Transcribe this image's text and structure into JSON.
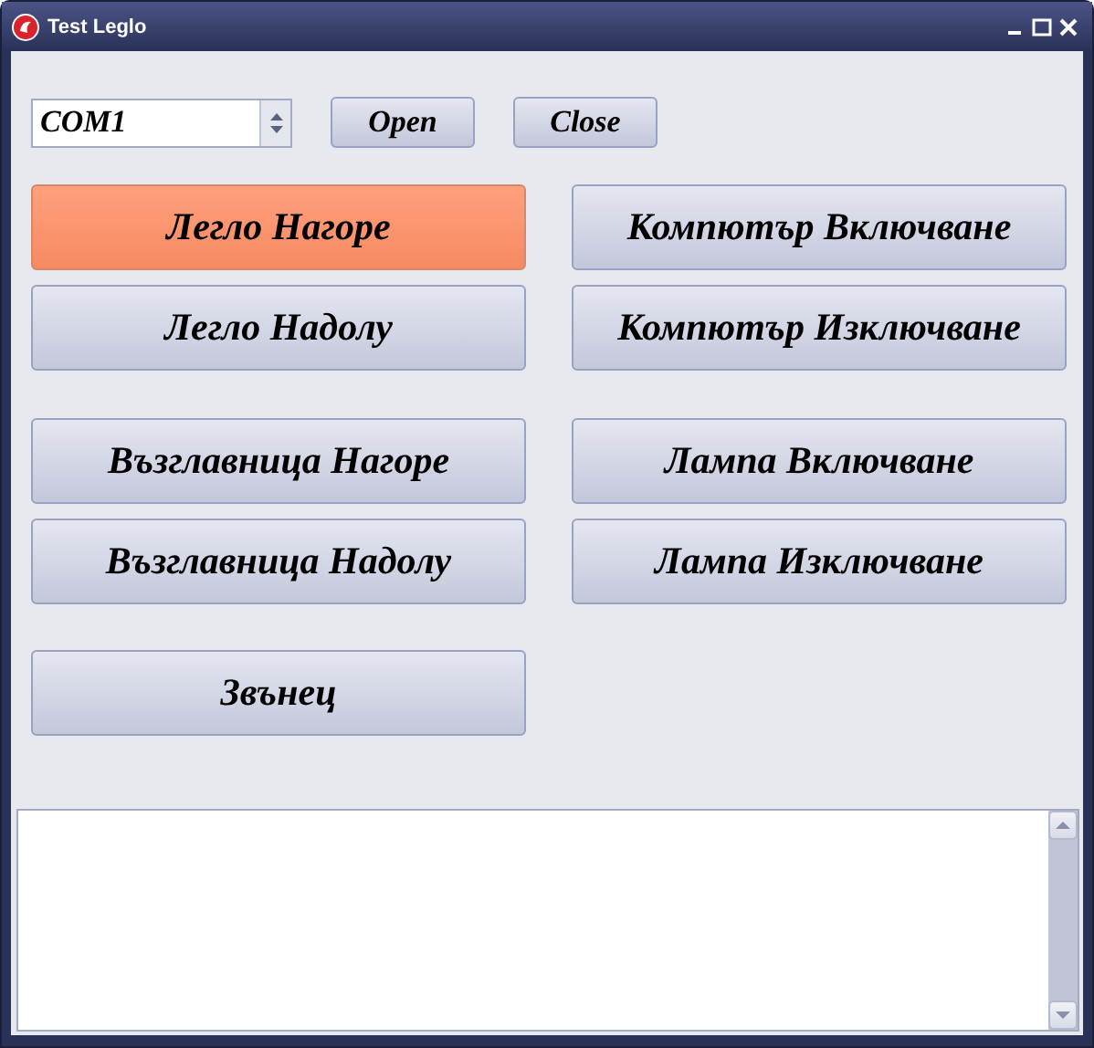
{
  "window": {
    "title": "Test Leglo"
  },
  "port": {
    "value": "COM1"
  },
  "port_buttons": [
    "Open",
    "Close"
  ],
  "button_rows": [
    {
      "buttons": [
        {
          "label": "Легло Нагоре",
          "highlighted": true
        },
        {
          "label": "Компютър Включване",
          "highlighted": false
        }
      ]
    },
    {
      "buttons": [
        {
          "label": "Легло Надолу",
          "highlighted": false
        },
        {
          "label": "Компютър Изключване",
          "highlighted": false
        }
      ]
    },
    {
      "buttons": [
        {
          "label": "Възглавница Нагоре",
          "highlighted": false
        },
        {
          "label": "Лампа Включване",
          "highlighted": false
        }
      ]
    },
    {
      "buttons": [
        {
          "label": "Възглавница Надолу",
          "highlighted": false
        },
        {
          "label": "Лампа Изключване",
          "highlighted": false
        }
      ]
    },
    {
      "buttons": [
        {
          "label": "Звънец",
          "highlighted": false
        }
      ]
    }
  ]
}
